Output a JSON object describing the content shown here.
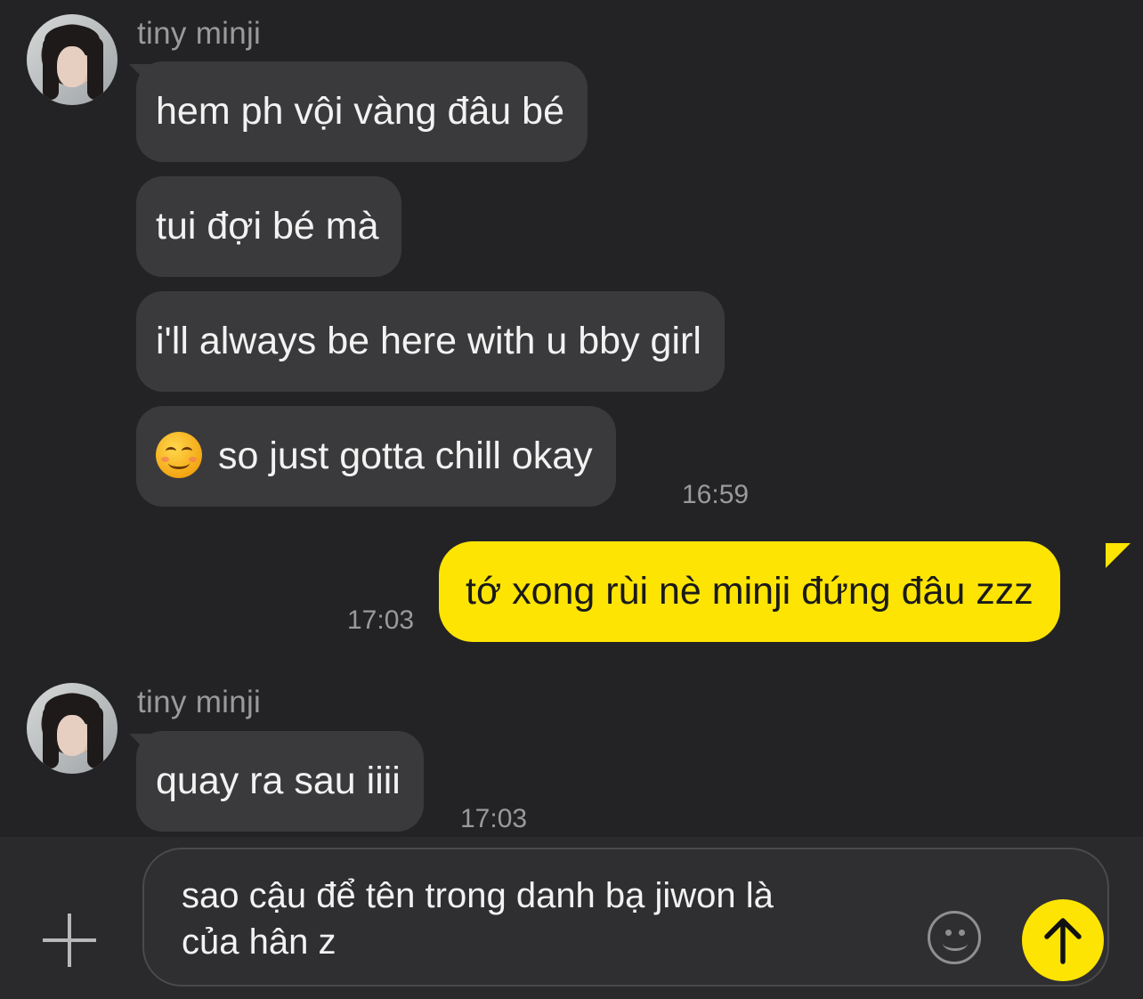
{
  "messages": [
    {
      "sender": "tiny minji",
      "direction": "incoming",
      "bubbles": [
        "hem ph vội vàng đâu bé",
        "tui đợi bé mà",
        "i'll always be here with u bby girl",
        "so just gotta chill okay"
      ],
      "time": "16:59"
    },
    {
      "direction": "outgoing",
      "bubbles": [
        "tớ xong rùi nè minji đứng đâu zzz"
      ],
      "time": "17:03"
    },
    {
      "sender": "tiny minji",
      "direction": "incoming",
      "bubbles": [
        "quay ra sau iiii"
      ],
      "time": "17:03"
    }
  ],
  "composer": {
    "text": "sao cậu để tên trong danh bạ jiwon là\ncủa hân z"
  },
  "icons": {
    "add": "plus-icon",
    "emoji": "emoji-icon",
    "send": "arrow-up-icon",
    "inline_emoji": "smiling-face-emoji"
  },
  "colors": {
    "background": "#232325",
    "incoming_bubble": "#3a3a3c",
    "outgoing_bubble": "#fde402",
    "timestamp": "#9a9a9d"
  }
}
